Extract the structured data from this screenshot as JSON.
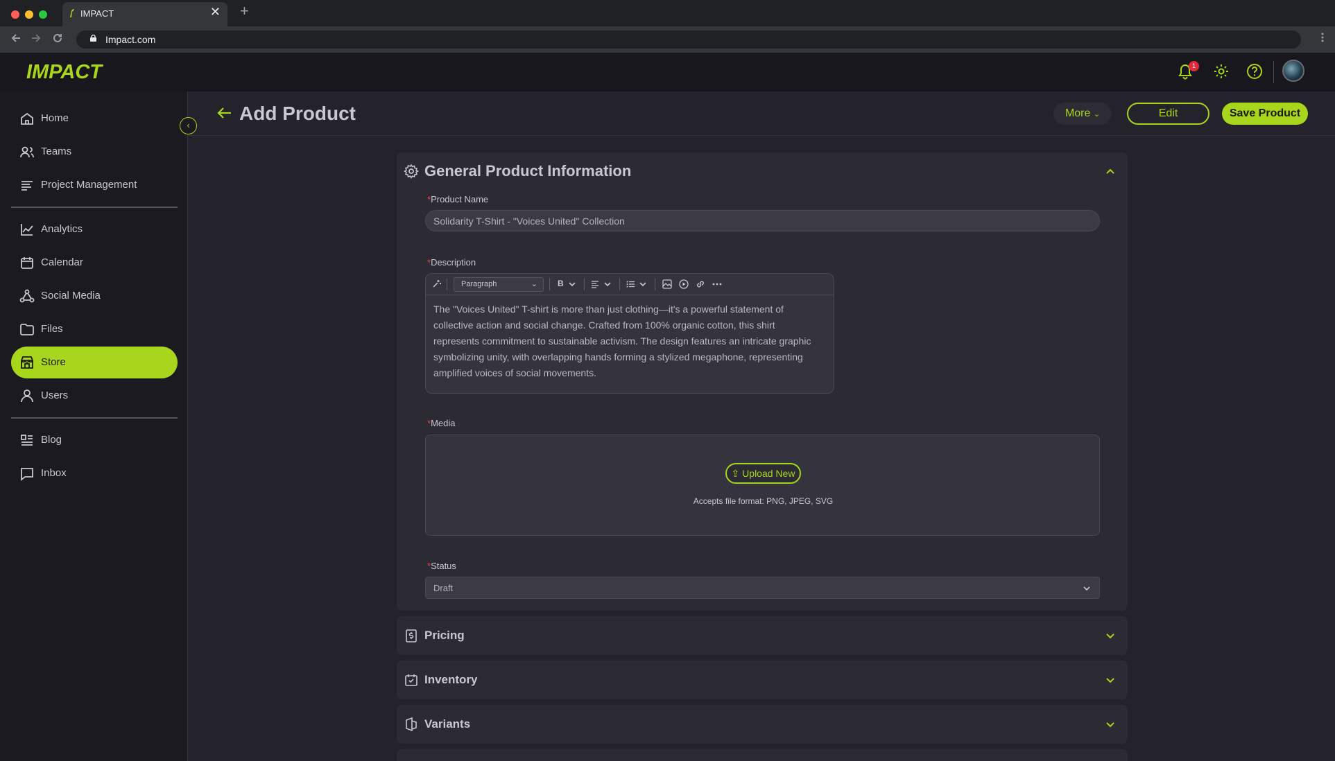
{
  "browser": {
    "tab_title": "IMPACT",
    "tab_close": "✕",
    "new_tab": "+",
    "url": "Impact.com"
  },
  "header": {
    "logo": "IMPACT",
    "notification_count": "1"
  },
  "sidebar": {
    "items": [
      {
        "label": "Home",
        "icon": "home-icon"
      },
      {
        "label": "Teams",
        "icon": "users-icon"
      },
      {
        "label": "Project Management",
        "icon": "list-icon"
      },
      {
        "label": "Analytics",
        "icon": "chart-icon"
      },
      {
        "label": "Calendar",
        "icon": "calendar-icon"
      },
      {
        "label": "Social Media",
        "icon": "share-icon"
      },
      {
        "label": "Files",
        "icon": "folder-icon"
      },
      {
        "label": "Store",
        "icon": "store-icon",
        "active": true
      },
      {
        "label": "Users",
        "icon": "user-icon"
      },
      {
        "label": "Blog",
        "icon": "blog-icon"
      },
      {
        "label": "Inbox",
        "icon": "inbox-icon"
      }
    ]
  },
  "page": {
    "title": "Add Product",
    "more_label": "More",
    "edit_label": "Edit",
    "save_label": "Save Product"
  },
  "general": {
    "title": "General Product Information",
    "product_name_label": "Product Name",
    "product_name_value": "Solidarity T-Shirt - \"Voices United\" Collection",
    "description_label": "Description",
    "paragraph_option": "Paragraph",
    "bold_label": "B",
    "description_text": "The \"Voices United\" T-shirt is more than just clothing—it's a powerful statement of collective action and social change. Crafted from 100% organic cotton, this shirt represents commitment to sustainable activism. The design features an intricate graphic symbolizing unity, with overlapping hands forming a stylized megaphone, representing amplified voices of social movements.",
    "media_label": "Media",
    "upload_label": "Upload New",
    "accepts_text": "Accepts file format: PNG, JPEG, SVG",
    "status_label": "Status",
    "status_value": "Draft",
    "required_mark": "*"
  },
  "sections": [
    {
      "label": "Pricing",
      "icon": "pricing-icon"
    },
    {
      "label": "Inventory",
      "icon": "inventory-icon"
    },
    {
      "label": "Variants",
      "icon": "variants-icon"
    }
  ],
  "colors": {
    "accent": "#a8d61c",
    "background": "#24232c",
    "sidebar": "#1b1a21",
    "card": "#2c2b34",
    "badge": "#e02b3c"
  }
}
